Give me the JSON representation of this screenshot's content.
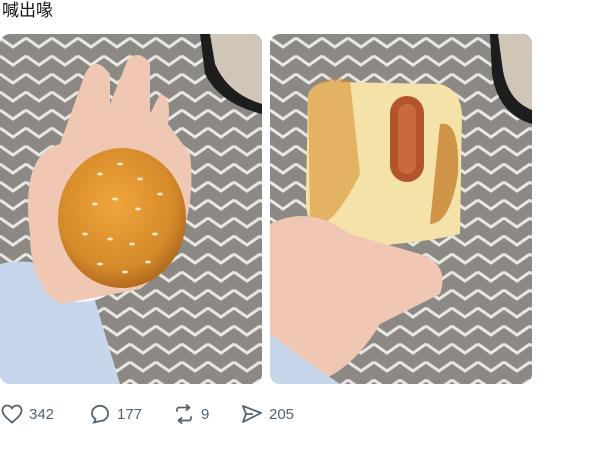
{
  "post": {
    "text": "喊出喙",
    "images": [
      {
        "icon": "burger-bun-photo"
      },
      {
        "icon": "sausage-bun-photo"
      }
    ]
  },
  "actions": {
    "likes": "342",
    "replies": "177",
    "reposts": "9",
    "shares": "205"
  },
  "colors": {
    "text": "#0f1419",
    "muted": "#536471",
    "bun": "#d58a2a",
    "blanket": "#8c8984"
  }
}
